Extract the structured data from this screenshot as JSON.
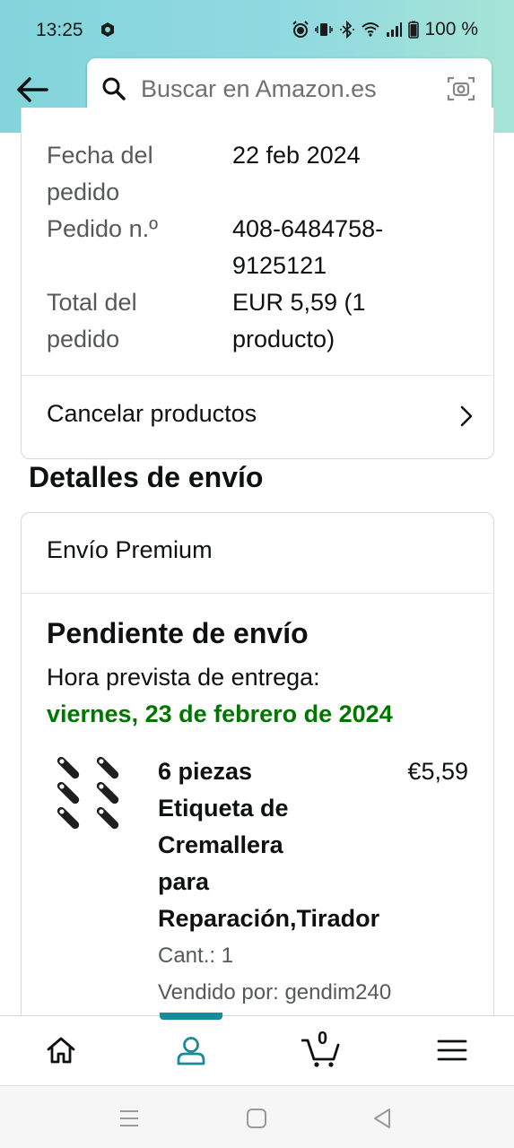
{
  "status_bar": {
    "time": "13:25",
    "battery": "100 %"
  },
  "search": {
    "placeholder": "Buscar en Amazon.es"
  },
  "order": {
    "date_label_line1": "Fecha del",
    "date_label_line2": "pedido",
    "date_value": "22 feb 2024",
    "number_label": "Pedido n.º",
    "number_value_line1": "408-6484758-",
    "number_value_line2": "9125121",
    "total_label_line1": "Total del",
    "total_label_line2": "pedido",
    "total_value_line1": "EUR 5,59 (1",
    "total_value_line2": "producto)",
    "cancel_label": "Cancelar productos"
  },
  "shipping": {
    "section_title": "Detalles de envío",
    "method": "Envío Premium",
    "status_title": "Pendiente de envío",
    "eta_label": "Hora prevista de entrega:",
    "eta_date": "viernes, 23 de febrero de 2024",
    "eta_color": "#007600"
  },
  "product": {
    "title_lines": [
      "6 piezas",
      "Etiqueta de",
      "Cremallera",
      "para",
      "Reparación,Tirador"
    ],
    "price": "€5,59",
    "quantity": "Cant.: 1",
    "seller": "Vendido por: gendim240"
  },
  "bottom_nav": {
    "items": [
      "home-icon",
      "account-icon",
      "cart-icon",
      "menu-icon"
    ],
    "cart_count": "0",
    "active_color": "#1a8a99"
  }
}
